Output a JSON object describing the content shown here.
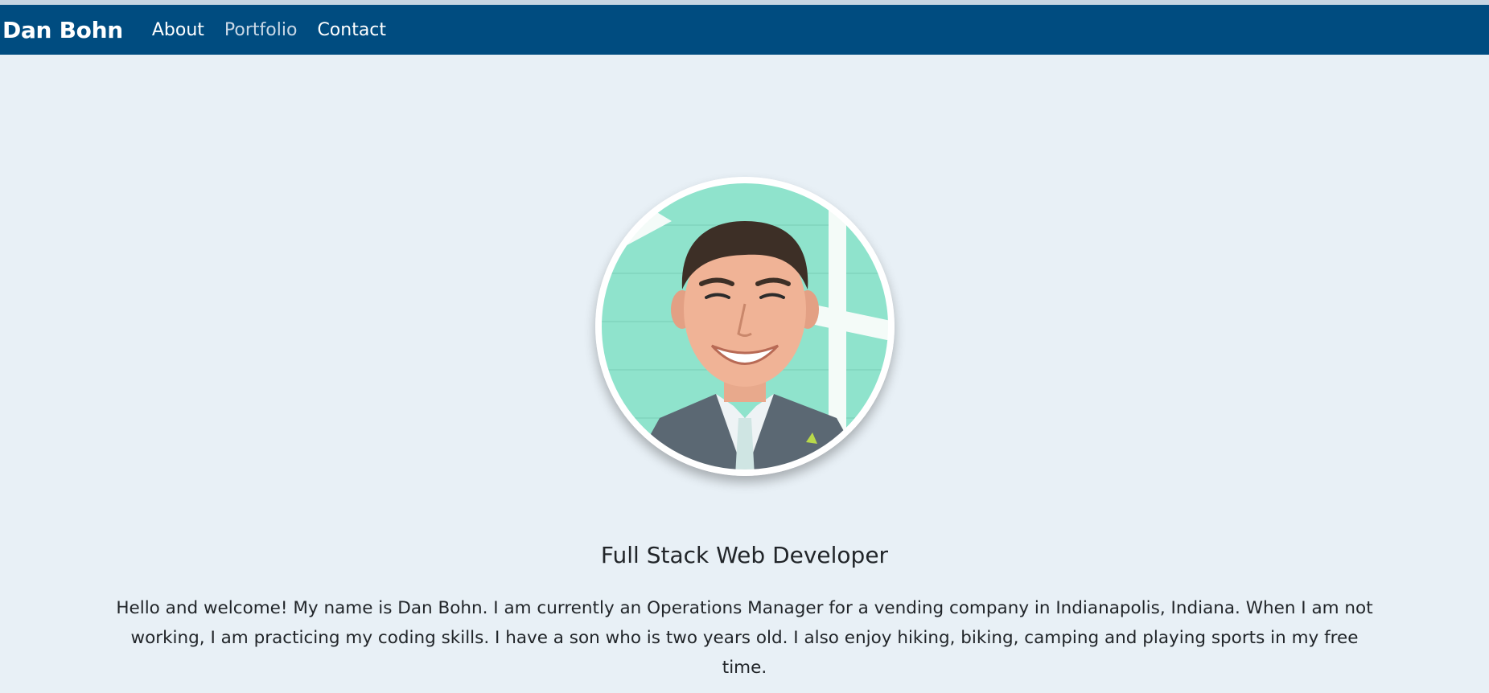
{
  "nav": {
    "brand": "Dan Bohn",
    "links": [
      {
        "label": "About"
      },
      {
        "label": "Portfolio"
      },
      {
        "label": "Contact"
      }
    ],
    "active_index": 1,
    "bg_color": "#004c80"
  },
  "hero": {
    "bg_color": "#e8f0f6",
    "title": "Full Stack Web Developer",
    "bio": "Hello and welcome! My name is Dan Bohn. I am currently an Operations Manager for a vending company in Indianapolis, Indiana. When I am not working, I am practicing my coding skills. I have a son who is two years old. I also enjoy hiking, biking, camping and playing sports in my free time."
  },
  "avatar": {
    "icon": "profile-photo"
  }
}
